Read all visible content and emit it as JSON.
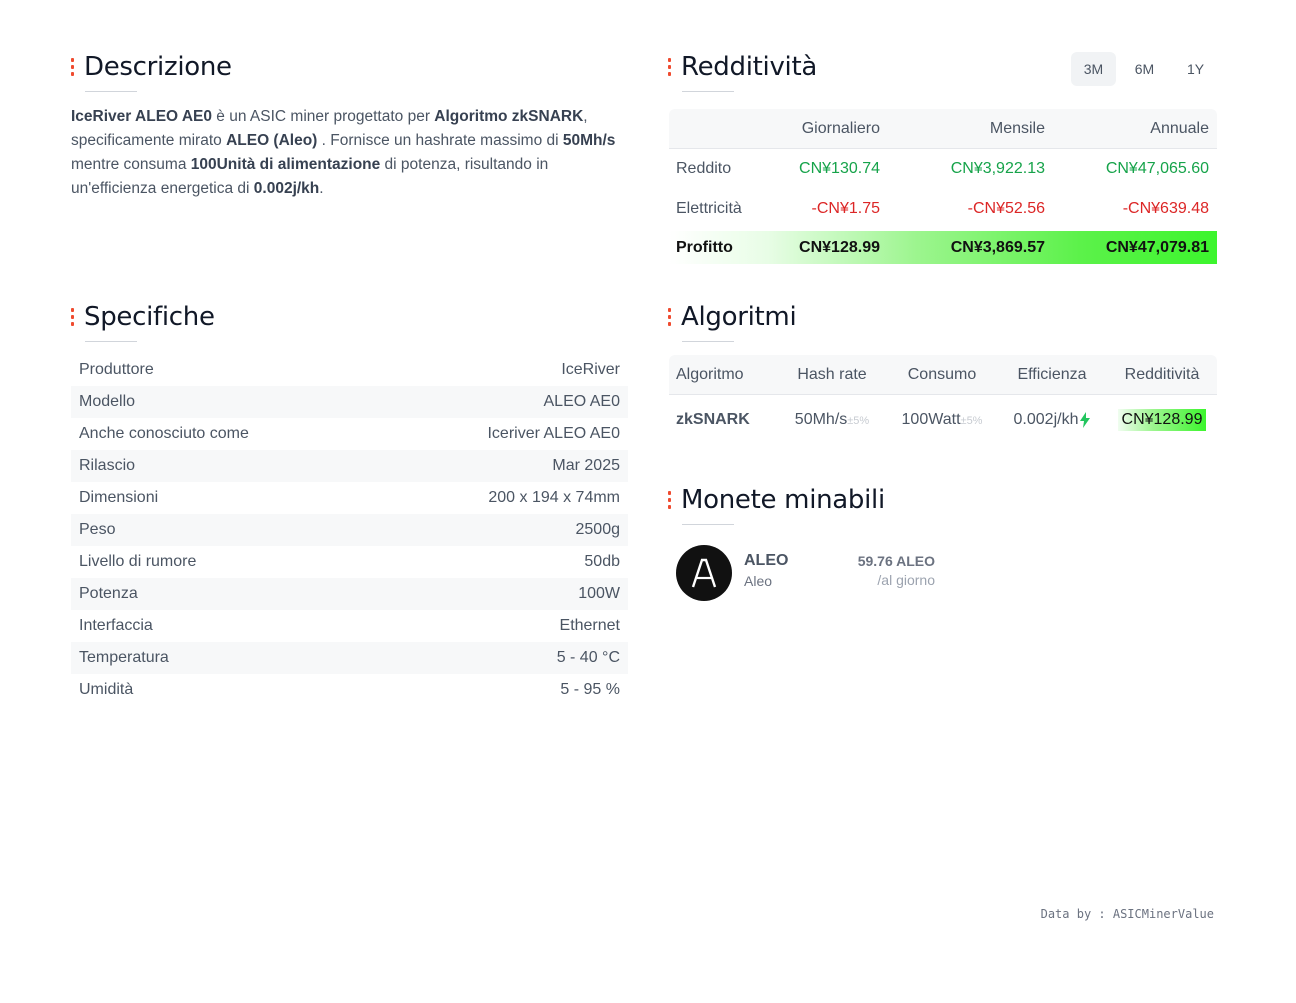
{
  "description": {
    "title": "Descrizione",
    "model_name": "IceRiver ALEO AE0",
    "t1": " è un ASIC miner progettato per ",
    "algorithm": "Algoritmo zkSNARK",
    "t2": ", specificamente mirato ",
    "coin": "ALEO (Aleo)",
    "t3": " . Fornisce un hashrate massimo di ",
    "hashrate": "50Mh/s",
    "t4": " mentre consuma ",
    "power": "100Unità di alimentazione",
    "t5": " di potenza, risultando in un'efficienza energetica di ",
    "efficiency": "0.002j/kh",
    "t6": "."
  },
  "profitability": {
    "title": "Redditività",
    "tabs": [
      "3M",
      "6M",
      "1Y"
    ],
    "active_tab": "3M",
    "headers": [
      "",
      "Giornaliero",
      "Mensile",
      "Annuale"
    ],
    "rows": [
      {
        "label": "Reddito",
        "daily": "CN¥130.74",
        "monthly": "CN¥3,922.13",
        "yearly": "CN¥47,065.60"
      },
      {
        "label": "Elettricità",
        "daily": "-CN¥1.75",
        "monthly": "-CN¥52.56",
        "yearly": "-CN¥639.48"
      },
      {
        "label": "Profitto",
        "daily": "CN¥128.99",
        "monthly": "CN¥3,869.57",
        "yearly": "CN¥47,079.81"
      }
    ],
    "colors": {
      "positive": "#16a34a",
      "negative": "#dc2626",
      "profit_gradient_end": "#3cf52d"
    }
  },
  "specs": {
    "title": "Specifiche",
    "rows": [
      {
        "label": "Produttore",
        "value": "IceRiver"
      },
      {
        "label": "Modello",
        "value": "ALEO AE0"
      },
      {
        "label": "Anche conosciuto come",
        "value": "Iceriver ALEO AE0"
      },
      {
        "label": "Rilascio",
        "value": "Mar 2025"
      },
      {
        "label": "Dimensioni",
        "value": "200 x 194 x 74mm"
      },
      {
        "label": "Peso",
        "value": "2500g"
      },
      {
        "label": "Livello di rumore",
        "value": "50db"
      },
      {
        "label": "Potenza",
        "value": "100W"
      },
      {
        "label": "Interfaccia",
        "value": "Ethernet"
      },
      {
        "label": "Temperatura",
        "value": "5 - 40 °C"
      },
      {
        "label": "Umidità",
        "value": "5 - 95 %"
      }
    ]
  },
  "algorithms": {
    "title": "Algoritmi",
    "headers": [
      "Algoritmo",
      "Hash rate",
      "Consumo",
      "Efficienza",
      "Redditività"
    ],
    "rows": [
      {
        "name": "zkSNARK",
        "hashrate": "50Mh/s",
        "hashrate_var": "±5%",
        "power": "100Watt",
        "power_var": "±5%",
        "efficiency": "0.002j/kh",
        "efficiency_icon": "lightning-icon",
        "revenue": "CN¥128.99"
      }
    ]
  },
  "coins": {
    "title": "Monete minabili",
    "items": [
      {
        "symbol": "ALEO",
        "name": "Aleo",
        "amount": "59.76 ALEO",
        "period": "/al giorno",
        "icon": "aleo-logo-icon"
      }
    ]
  },
  "footer": {
    "text": "Data by : ASICMinerValue"
  },
  "accent_color": "#ef4b2f"
}
